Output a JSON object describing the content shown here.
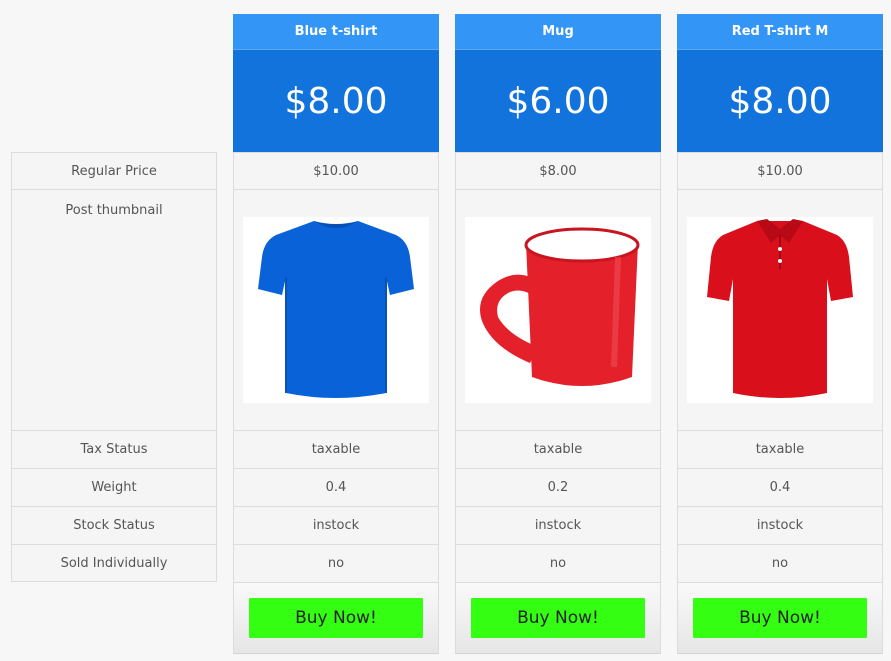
{
  "labels": {
    "regular_price": "Regular Price",
    "post_thumbnail": "Post thumbnail",
    "tax_status": "Tax Status",
    "weight": "Weight",
    "stock_status": "Stock Status",
    "sold_individually": "Sold Individually"
  },
  "buy_label": "Buy Now!",
  "colors": {
    "header": "#3395f5",
    "price_bg": "#1273dd",
    "buy_button": "#34ff12",
    "blue_tshirt": "#0a62d8",
    "mug": "#e4202b",
    "red_tshirt": "#d90f1c"
  },
  "products": [
    {
      "name": "Blue t-shirt",
      "price": "$8.00",
      "regular_price": "$10.00",
      "thumbnail_icon": "blue-tshirt-icon",
      "tax_status": "taxable",
      "weight": "0.4",
      "stock_status": "instock",
      "sold_individually": "no"
    },
    {
      "name": "Mug",
      "price": "$6.00",
      "regular_price": "$8.00",
      "thumbnail_icon": "red-mug-icon",
      "tax_status": "taxable",
      "weight": "0.2",
      "stock_status": "instock",
      "sold_individually": "no"
    },
    {
      "name": "Red T-shirt M",
      "price": "$8.00",
      "regular_price": "$10.00",
      "thumbnail_icon": "red-polo-shirt-icon",
      "tax_status": "taxable",
      "weight": "0.4",
      "stock_status": "instock",
      "sold_individually": "no"
    }
  ]
}
